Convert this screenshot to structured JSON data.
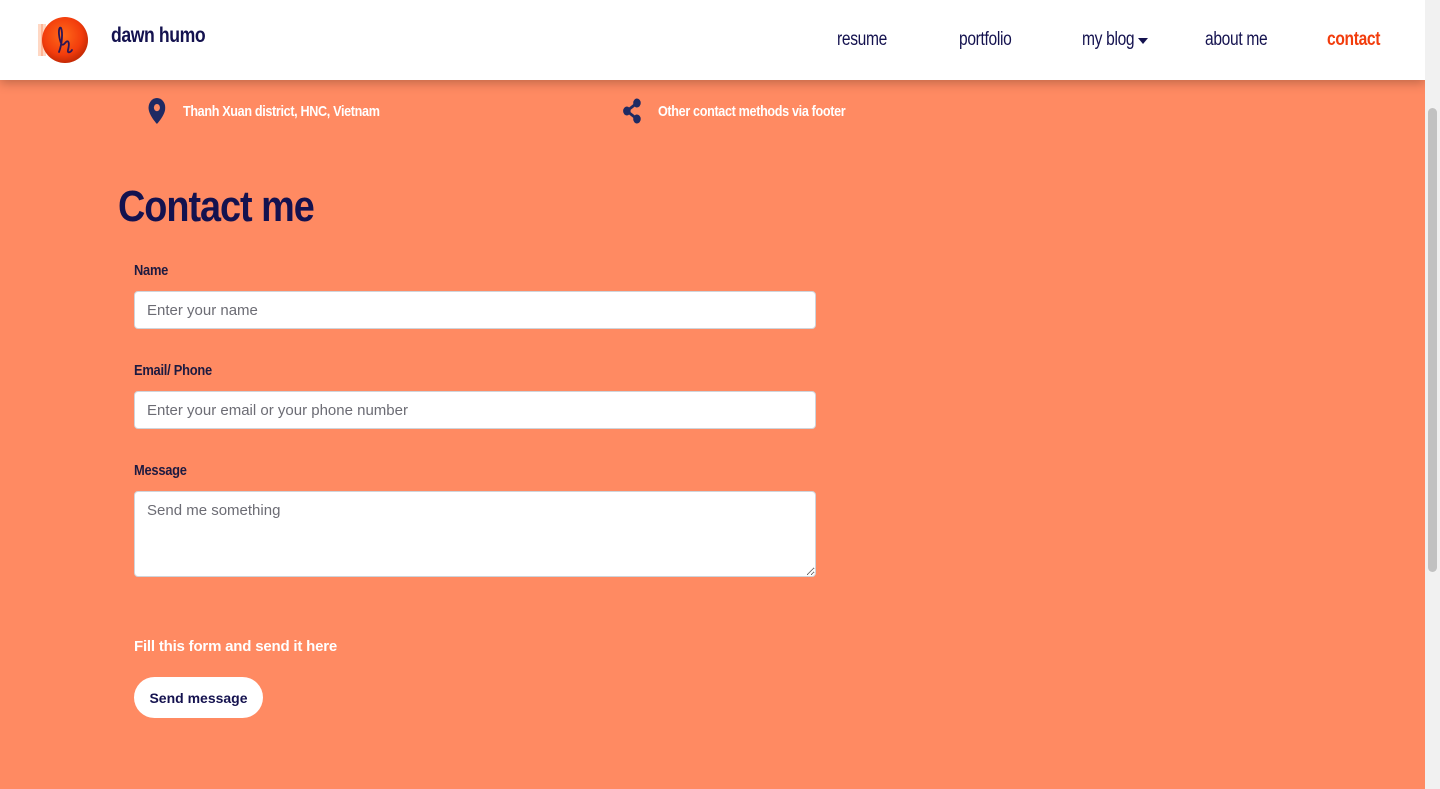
{
  "header": {
    "brand": "dawn humo",
    "logo_letter": "h",
    "nav": {
      "resume": "resume",
      "portfolio": "portfolio",
      "blog": "my blog",
      "about": "about me",
      "contact": "contact"
    }
  },
  "info": {
    "location": "Thanh Xuan district, HNC, Vietnam",
    "footer": "Other contact methods via footer",
    "location_icon": "map-pin-icon",
    "footer_icon": "share-icon"
  },
  "contact": {
    "title": "Contact me",
    "name_label": "Name",
    "name_placeholder": "Enter your name",
    "email_label": "Email/ Phone",
    "email_placeholder": "Enter your email or your phone number",
    "message_label": "Message",
    "message_placeholder": "Send me something",
    "hint": "Fill this form and send it here",
    "send_label": "Send message"
  },
  "colors": {
    "background": "#ff8a62",
    "navy": "#14124f",
    "active_nav": "#f23c0c",
    "white": "#ffffff"
  }
}
